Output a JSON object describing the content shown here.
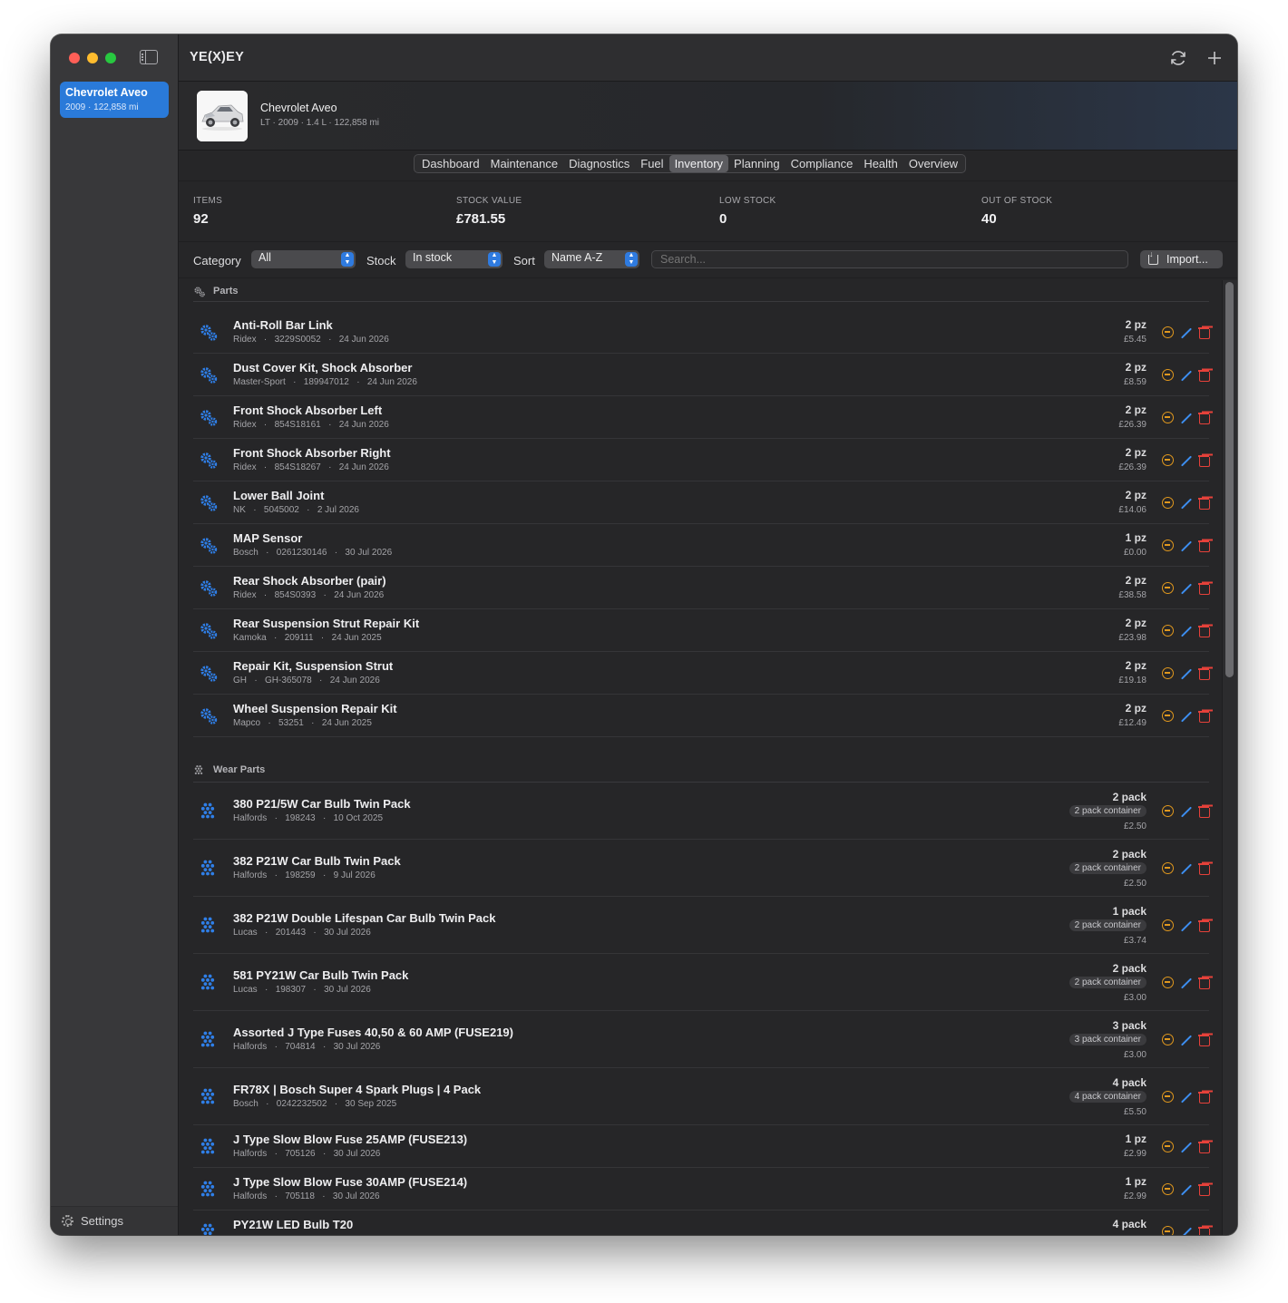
{
  "sidebar": {
    "vehicles": [
      {
        "name": "Chevrolet Aveo",
        "meta": "2009 · 122,858 mi"
      }
    ],
    "settings_label": "Settings"
  },
  "app": {
    "title": "YE(X)EY"
  },
  "vehicle": {
    "name": "Chevrolet Aveo",
    "meta": "LT · 2009 · 1.4 L · 122,858 mi"
  },
  "tabs": [
    {
      "label": "Dashboard",
      "active": false
    },
    {
      "label": "Maintenance",
      "active": false
    },
    {
      "label": "Diagnostics",
      "active": false
    },
    {
      "label": "Fuel",
      "active": false
    },
    {
      "label": "Inventory",
      "active": true
    },
    {
      "label": "Planning",
      "active": false
    },
    {
      "label": "Compliance",
      "active": false
    },
    {
      "label": "Health",
      "active": false
    },
    {
      "label": "Overview",
      "active": false
    }
  ],
  "stats": {
    "items": {
      "label": "ITEMS",
      "value": "92"
    },
    "stock_value": {
      "label": "STOCK VALUE",
      "value": "£781.55"
    },
    "low_stock": {
      "label": "LOW STOCK",
      "value": "0"
    },
    "out_of_stock": {
      "label": "OUT OF STOCK",
      "value": "40"
    }
  },
  "filters": {
    "category_label": "Category",
    "category_value": "All",
    "stock_label": "Stock",
    "stock_value": "In stock",
    "sort_label": "Sort",
    "sort_value": "Name A-Z",
    "search_placeholder": "Search...",
    "import_label": "Import..."
  },
  "sections": [
    {
      "title": "Parts",
      "icon": "gears-icon",
      "items": [
        {
          "name": "Anti-Roll Bar Link",
          "brand": "Ridex",
          "code": "3229S0052",
          "date": "24 Jun 2026",
          "qty": "2 pz",
          "price": "£5.45"
        },
        {
          "name": "Dust Cover Kit, Shock Absorber",
          "brand": "Master-Sport",
          "code": "189947012",
          "date": "24 Jun 2026",
          "qty": "2 pz",
          "price": "£8.59"
        },
        {
          "name": "Front Shock Absorber Left",
          "brand": "Ridex",
          "code": "854S18161",
          "date": "24 Jun 2026",
          "qty": "2 pz",
          "price": "£26.39"
        },
        {
          "name": "Front Shock Absorber Right",
          "brand": "Ridex",
          "code": "854S18267",
          "date": "24 Jun 2026",
          "qty": "2 pz",
          "price": "£26.39"
        },
        {
          "name": "Lower Ball Joint",
          "brand": "NK",
          "code": "5045002",
          "date": "2 Jul 2026",
          "qty": "2 pz",
          "price": "£14.06"
        },
        {
          "name": "MAP Sensor",
          "brand": "Bosch",
          "code": "0261230146",
          "date": "30 Jul 2026",
          "qty": "1 pz",
          "price": "£0.00"
        },
        {
          "name": "Rear Shock Absorber (pair)",
          "brand": "Ridex",
          "code": "854S0393",
          "date": "24 Jun 2026",
          "qty": "2 pz",
          "price": "£38.58"
        },
        {
          "name": "Rear Suspension Strut Repair Kit",
          "brand": "Kamoka",
          "code": "209111",
          "date": "24 Jun 2025",
          "qty": "2 pz",
          "price": "£23.98"
        },
        {
          "name": "Repair Kit, Suspension Strut",
          "brand": "GH",
          "code": "GH-365078",
          "date": "24 Jun 2026",
          "qty": "2 pz",
          "price": "£19.18"
        },
        {
          "name": "Wheel Suspension Repair Kit",
          "brand": "Mapco",
          "code": "53251",
          "date": "24 Jun 2025",
          "qty": "2 pz",
          "price": "£12.49"
        }
      ]
    },
    {
      "title": "Wear Parts",
      "icon": "dots-cluster-icon",
      "items": [
        {
          "name": "380 P21/5W Car Bulb Twin Pack",
          "brand": "Halfords",
          "code": "198243",
          "date": "10 Oct 2025",
          "qty": "2 pack",
          "badge": "2 pack container",
          "price": "£2.50"
        },
        {
          "name": "382 P21W Car Bulb Twin Pack",
          "brand": "Halfords",
          "code": "198259",
          "date": "9 Jul 2026",
          "qty": "2 pack",
          "badge": "2 pack container",
          "price": "£2.50"
        },
        {
          "name": "382 P21W Double Lifespan Car Bulb Twin Pack",
          "brand": "Lucas",
          "code": "201443",
          "date": "30 Jul 2026",
          "qty": "1 pack",
          "badge": "2 pack container",
          "price": "£3.74"
        },
        {
          "name": "581 PY21W Car Bulb Twin Pack",
          "brand": "Lucas",
          "code": "198307",
          "date": "30 Jul 2026",
          "qty": "2 pack",
          "badge": "2 pack container",
          "price": "£3.00"
        },
        {
          "name": "Assorted J Type Fuses 40,50 & 60 AMP (FUSE219)",
          "brand": "Halfords",
          "code": "704814",
          "date": "30 Jul 2026",
          "qty": "3 pack",
          "badge": "3 pack container",
          "price": "£3.00"
        },
        {
          "name": "FR78X |  Bosch Super 4 Spark Plugs | 4 Pack",
          "brand": "Bosch",
          "code": "0242232502",
          "date": "30 Sep 2025",
          "qty": "4 pack",
          "badge": "4 pack container",
          "price": "£5.50"
        },
        {
          "name": "J Type Slow Blow Fuse 25AMP (FUSE213)",
          "brand": "Halfords",
          "code": "705126",
          "date": "30 Jul 2026",
          "qty": "1 pz",
          "price": "£2.99"
        },
        {
          "name": "J Type Slow Blow Fuse 30AMP (FUSE214)",
          "brand": "Halfords",
          "code": "705118",
          "date": "30 Jul 2026",
          "qty": "1 pz",
          "price": "£2.99"
        },
        {
          "name": "PY21W LED Bulb T20",
          "brand": "",
          "code": "",
          "date": "",
          "qty": "4 pack",
          "badge": "",
          "price": ""
        }
      ]
    }
  ],
  "colors": {
    "accent": "#2a7ad9",
    "icon_blue": "#2f7fe8",
    "minus_orange": "#e0981e",
    "edit_blue": "#3d8ef0",
    "delete_red": "#e5413a"
  }
}
